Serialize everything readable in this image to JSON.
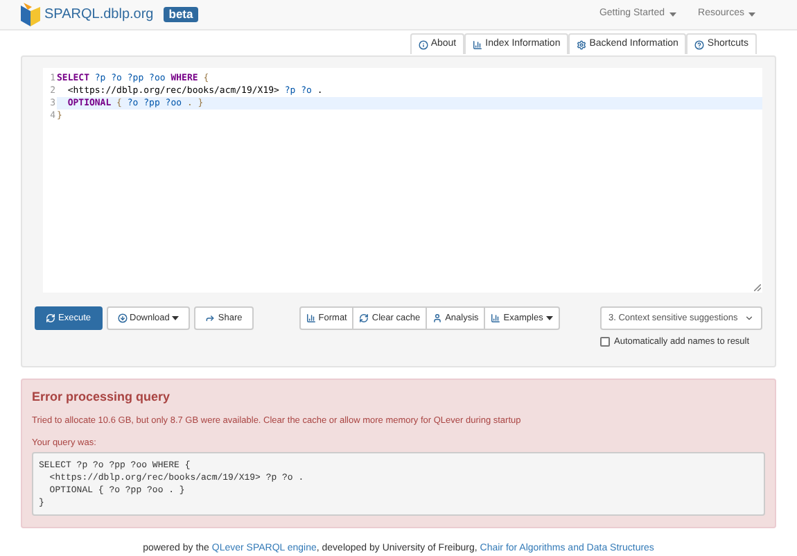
{
  "navbar": {
    "brand": "SPARQL.dblp.org",
    "badge": "beta",
    "menus": [
      {
        "label": "Getting Started"
      },
      {
        "label": "Resources"
      }
    ]
  },
  "tabs": [
    {
      "label": "About"
    },
    {
      "label": "Index Information"
    },
    {
      "label": "Backend Information"
    },
    {
      "label": "Shortcuts"
    }
  ],
  "editor": {
    "lines": [
      {
        "number": "1",
        "highlighted": false,
        "tokens": [
          {
            "text": "SELECT",
            "kind": "keyword"
          },
          {
            "text": " ?p",
            "kind": "variable"
          },
          {
            "text": " ?o",
            "kind": "variable"
          },
          {
            "text": " ?pp",
            "kind": "variable"
          },
          {
            "text": " ?oo",
            "kind": "variable"
          },
          {
            "text": " WHERE",
            "kind": "keyword"
          },
          {
            "text": " {",
            "kind": "punct"
          }
        ]
      },
      {
        "number": "2",
        "highlighted": false,
        "tokens": [
          {
            "text": "  <https://dblp.org/rec/books/acm/19/X19>",
            "kind": "plain"
          },
          {
            "text": " ?p",
            "kind": "variable"
          },
          {
            "text": " ?o",
            "kind": "variable"
          },
          {
            "text": " .",
            "kind": "plain"
          }
        ]
      },
      {
        "number": "3",
        "highlighted": true,
        "tokens": [
          {
            "text": "  OPTIONAL",
            "kind": "keyword"
          },
          {
            "text": " { ",
            "kind": "punct"
          },
          {
            "text": "?o",
            "kind": "variable"
          },
          {
            "text": " ?pp",
            "kind": "variable"
          },
          {
            "text": " ?oo",
            "kind": "variable"
          },
          {
            "text": " . }",
            "kind": "punct"
          }
        ]
      },
      {
        "number": "4",
        "highlighted": false,
        "tokens": [
          {
            "text": "}",
            "kind": "punct"
          }
        ]
      }
    ]
  },
  "toolbar": {
    "left": [
      {
        "label": "Execute",
        "kind": "primary",
        "caret": false
      },
      {
        "label": "Download",
        "kind": "default",
        "caret": true
      },
      {
        "label": "Share",
        "kind": "default",
        "caret": false
      }
    ],
    "middle": [
      {
        "label": "Format",
        "caret": false
      },
      {
        "label": "Clear cache",
        "caret": false
      },
      {
        "label": "Analysis",
        "caret": false
      },
      {
        "label": "Examples",
        "caret": true
      }
    ],
    "select": {
      "value": "3. Context sensitive suggestions"
    },
    "checkbox": {
      "label": "Automatically add names to result",
      "checked": false
    }
  },
  "error": {
    "title": "Error processing query",
    "message": "Tried to allocate 10.6 GB, but only 8.7 GB were available. Clear the cache or allow more memory for QLever during startup",
    "query_label": "Your query was:",
    "query_lines": [
      "SELECT ?p ?o ?pp ?oo WHERE {",
      "  <https://dblp.org/rec/books/acm/19/X19> ?p ?o .",
      "  OPTIONAL { ?o ?pp ?oo . }",
      "}"
    ]
  },
  "footer": {
    "parts": [
      {
        "text": "powered by the ",
        "kind": "text"
      },
      {
        "text": "QLever SPARQL engine",
        "kind": "link"
      },
      {
        "text": ", developed by University of Freiburg, ",
        "kind": "text"
      },
      {
        "text": "Chair for Algorithms and Data Structures",
        "kind": "link"
      }
    ]
  }
}
